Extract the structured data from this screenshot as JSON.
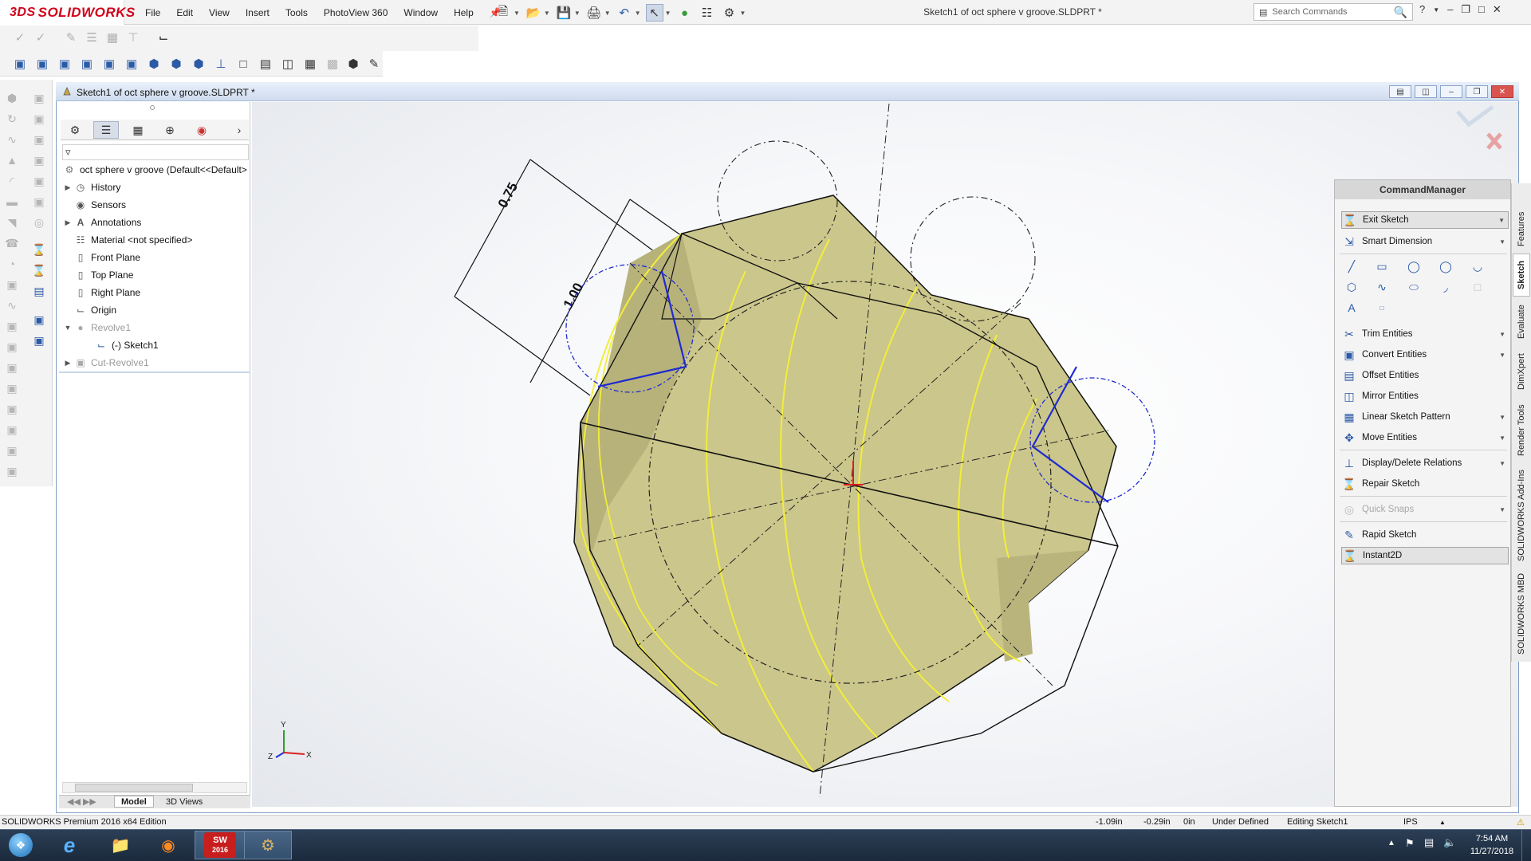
{
  "app": {
    "brand": "SOLIDWORKS"
  },
  "menu": [
    "File",
    "Edit",
    "View",
    "Insert",
    "Tools",
    "PhotoView 360",
    "Window",
    "Help"
  ],
  "window": {
    "title": "Sketch1 of oct sphere v groove.SLDPRT *"
  },
  "search": {
    "placeholder": "Search Commands"
  },
  "doc_window": {
    "title": "Sketch1 of oct sphere v groove.SLDPRT *"
  },
  "feature_tree": {
    "root": "oct sphere v groove  (Default<<Default>",
    "items": [
      {
        "label": "History",
        "icon": "history-icon",
        "expandable": true
      },
      {
        "label": "Sensors",
        "icon": "sensor-icon",
        "expandable": false
      },
      {
        "label": "Annotations",
        "icon": "annotations-icon",
        "expandable": true
      },
      {
        "label": "Material <not specified>",
        "icon": "material-icon",
        "expandable": false
      },
      {
        "label": "Front Plane",
        "icon": "plane-icon",
        "expandable": false
      },
      {
        "label": "Top Plane",
        "icon": "plane-icon",
        "expandable": false
      },
      {
        "label": "Right Plane",
        "icon": "plane-icon",
        "expandable": false
      },
      {
        "label": "Origin",
        "icon": "origin-icon",
        "expandable": false
      },
      {
        "label": "Revolve1",
        "icon": "revolve-icon",
        "expandable": true,
        "dim": true
      },
      {
        "label": "(-) Sketch1",
        "icon": "sketch-icon",
        "expandable": false,
        "child": true
      },
      {
        "label": "Cut-Revolve1",
        "icon": "cut-revolve-icon",
        "expandable": true,
        "dim": true
      }
    ]
  },
  "bottom_tabs": [
    "Model",
    "3D Views"
  ],
  "graphics": {
    "dim_a": "0.75",
    "dim_b": "1.00",
    "triad": {
      "x": "X",
      "y": "Y",
      "z": "Z"
    },
    "colors": {
      "body": "#c8c184",
      "edge_highlight": "#f2ee3a",
      "sketch_blue": "#1f2bd0"
    }
  },
  "command_manager": {
    "title": "CommandManager",
    "items": [
      {
        "label": "Exit Sketch",
        "icon": "exit-sketch-icon"
      },
      {
        "label": "Smart Dimension",
        "icon": "smart-dimension-icon"
      },
      {
        "label": "Trim Entities",
        "icon": "trim-icon"
      },
      {
        "label": "Convert Entities",
        "icon": "convert-icon"
      },
      {
        "label": "Offset Entities",
        "icon": "offset-icon"
      },
      {
        "label": "Mirror Entities",
        "icon": "mirror-icon"
      },
      {
        "label": "Linear Sketch Pattern",
        "icon": "linear-pattern-icon"
      },
      {
        "label": "Move Entities",
        "icon": "move-icon"
      },
      {
        "label": "Display/Delete Relations",
        "icon": "relations-icon"
      },
      {
        "label": "Repair Sketch",
        "icon": "repair-icon"
      },
      {
        "label": "Quick Snaps",
        "icon": "snap-icon"
      },
      {
        "label": "Rapid Sketch",
        "icon": "rapid-sketch-icon"
      },
      {
        "label": "Instant2D",
        "icon": "instant2d-icon"
      }
    ],
    "tabs": [
      "Features",
      "Sketch",
      "Evaluate",
      "DimXpert",
      "Render Tools",
      "SOLIDWORKS Add-Ins",
      "SOLIDWORKS MBD"
    ]
  },
  "status": {
    "edition": "SOLIDWORKS Premium 2016 x64 Edition",
    "x": "-1.09in",
    "y": "-0.29in",
    "z": "0in",
    "state": "Under Defined",
    "mode": "Editing Sketch1",
    "units": "IPS"
  },
  "taskbar": {
    "time": "7:54 AM",
    "date": "11/27/2018",
    "sw_badge": "2016"
  }
}
